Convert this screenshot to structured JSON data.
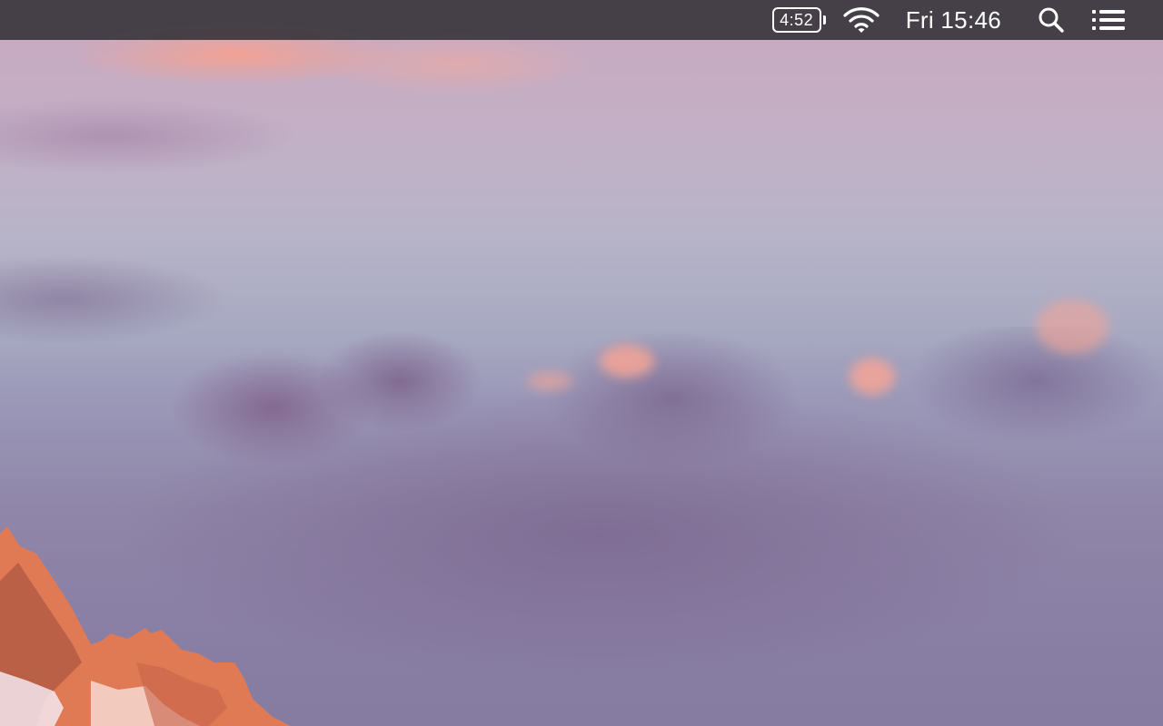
{
  "menubar": {
    "battery": {
      "label": "4:52",
      "icon": "battery-icon"
    },
    "wifi": {
      "icon": "wifi-icon"
    },
    "clock": {
      "text": "Fri 15:46"
    },
    "spotlight": {
      "icon": "search-icon"
    },
    "notification_center": {
      "icon": "list-icon"
    }
  },
  "desktop": {
    "wallpaper": "mountain-sunset-clouds",
    "colors": {
      "menubar": "#28282d",
      "sky_top": "#c9a8bf",
      "sky_bottom": "#857ca2",
      "peak": "#e07a55"
    }
  }
}
